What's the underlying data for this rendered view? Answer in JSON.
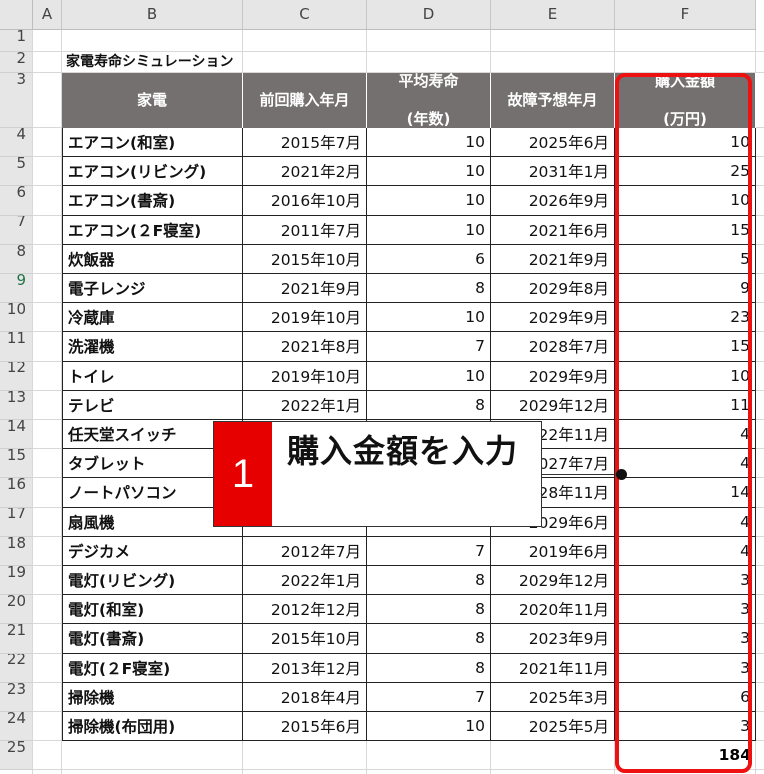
{
  "columns": [
    "A",
    "B",
    "C",
    "D",
    "E",
    "F"
  ],
  "row_numbers": [
    "1",
    "2",
    "3",
    "4",
    "5",
    "6",
    "7",
    "8",
    "9",
    "10",
    "11",
    "12",
    "13",
    "14",
    "15",
    "16",
    "17",
    "18",
    "19",
    "20",
    "21",
    "22",
    "23",
    "24",
    "25"
  ],
  "selected_row": "9",
  "sheet_title": "家電寿命シミュレーション",
  "table": {
    "headers": [
      "家電",
      "前回購入年月",
      "平均寿命\n(年数)",
      "故障予想年月",
      "購入金額\n(万円)"
    ],
    "rows": [
      [
        "エアコン(和室)",
        "2015年7月",
        "10",
        "2025年6月",
        "10"
      ],
      [
        "エアコン(リビング)",
        "2021年2月",
        "10",
        "2031年1月",
        "25"
      ],
      [
        "エアコン(書斎)",
        "2016年10月",
        "10",
        "2026年9月",
        "10"
      ],
      [
        "エアコン(２F寝室)",
        "2011年7月",
        "10",
        "2021年6月",
        "15"
      ],
      [
        "炊飯器",
        "2015年10月",
        "6",
        "2021年9月",
        "5"
      ],
      [
        "電子レンジ",
        "2021年9月",
        "8",
        "2029年8月",
        "9"
      ],
      [
        "冷蔵庫",
        "2019年10月",
        "10",
        "2029年9月",
        "23"
      ],
      [
        "洗濯機",
        "2021年8月",
        "7",
        "2028年7月",
        "15"
      ],
      [
        "トイレ",
        "2019年10月",
        "10",
        "2029年9月",
        "10"
      ],
      [
        "テレビ",
        "2022年1月",
        "8",
        "2029年12月",
        "11"
      ],
      [
        "任天堂スイッチ",
        "",
        "",
        "2022年11月",
        "4"
      ],
      [
        "タブレット",
        "",
        "",
        "2027年7月",
        "4"
      ],
      [
        "ノートパソコン",
        "",
        "",
        "2028年11月",
        "14"
      ],
      [
        "扇風機",
        "",
        "",
        "2029年6月",
        "4"
      ],
      [
        "デジカメ",
        "2012年7月",
        "7",
        "2019年6月",
        "4"
      ],
      [
        "電灯(リビング)",
        "2022年1月",
        "8",
        "2029年12月",
        "3"
      ],
      [
        "電灯(和室)",
        "2012年12月",
        "8",
        "2020年11月",
        "3"
      ],
      [
        "電灯(書斎)",
        "2015年10月",
        "8",
        "2023年9月",
        "3"
      ],
      [
        "電灯(２F寝室)",
        "2013年12月",
        "8",
        "2021年11月",
        "3"
      ],
      [
        "掃除機",
        "2018年4月",
        "7",
        "2025年3月",
        "6"
      ],
      [
        "掃除機(布団用)",
        "2015年6月",
        "10",
        "2025年5月",
        "3"
      ]
    ],
    "total": "184"
  },
  "callout": {
    "number": "1",
    "text": "購入金額を入力"
  },
  "colors": {
    "header_bg": "#757070",
    "highlight": "#ee1111",
    "callout_number_bg": "#e60000",
    "selected_header": "#217346"
  }
}
